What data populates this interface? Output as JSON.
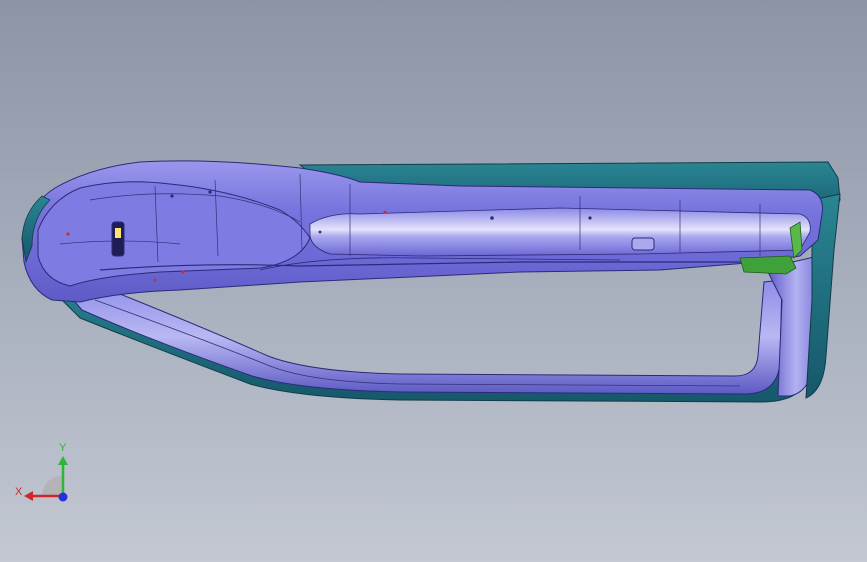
{
  "viewport": {
    "background_top": "#8c95a6",
    "background_bottom": "#c3c8d2"
  },
  "model": {
    "name": "",
    "body_color": "#7b78e0",
    "body_highlight": "#c9c8f7",
    "edge_color": "#1f3e56",
    "teal_color": "#1f6f7e",
    "bracket_color": "#3fa13a"
  },
  "triad": {
    "x_label": "X",
    "y_label": "Y",
    "x_color": "#d0262a",
    "y_color": "#2fb53a",
    "z_color": "#2433d8"
  }
}
